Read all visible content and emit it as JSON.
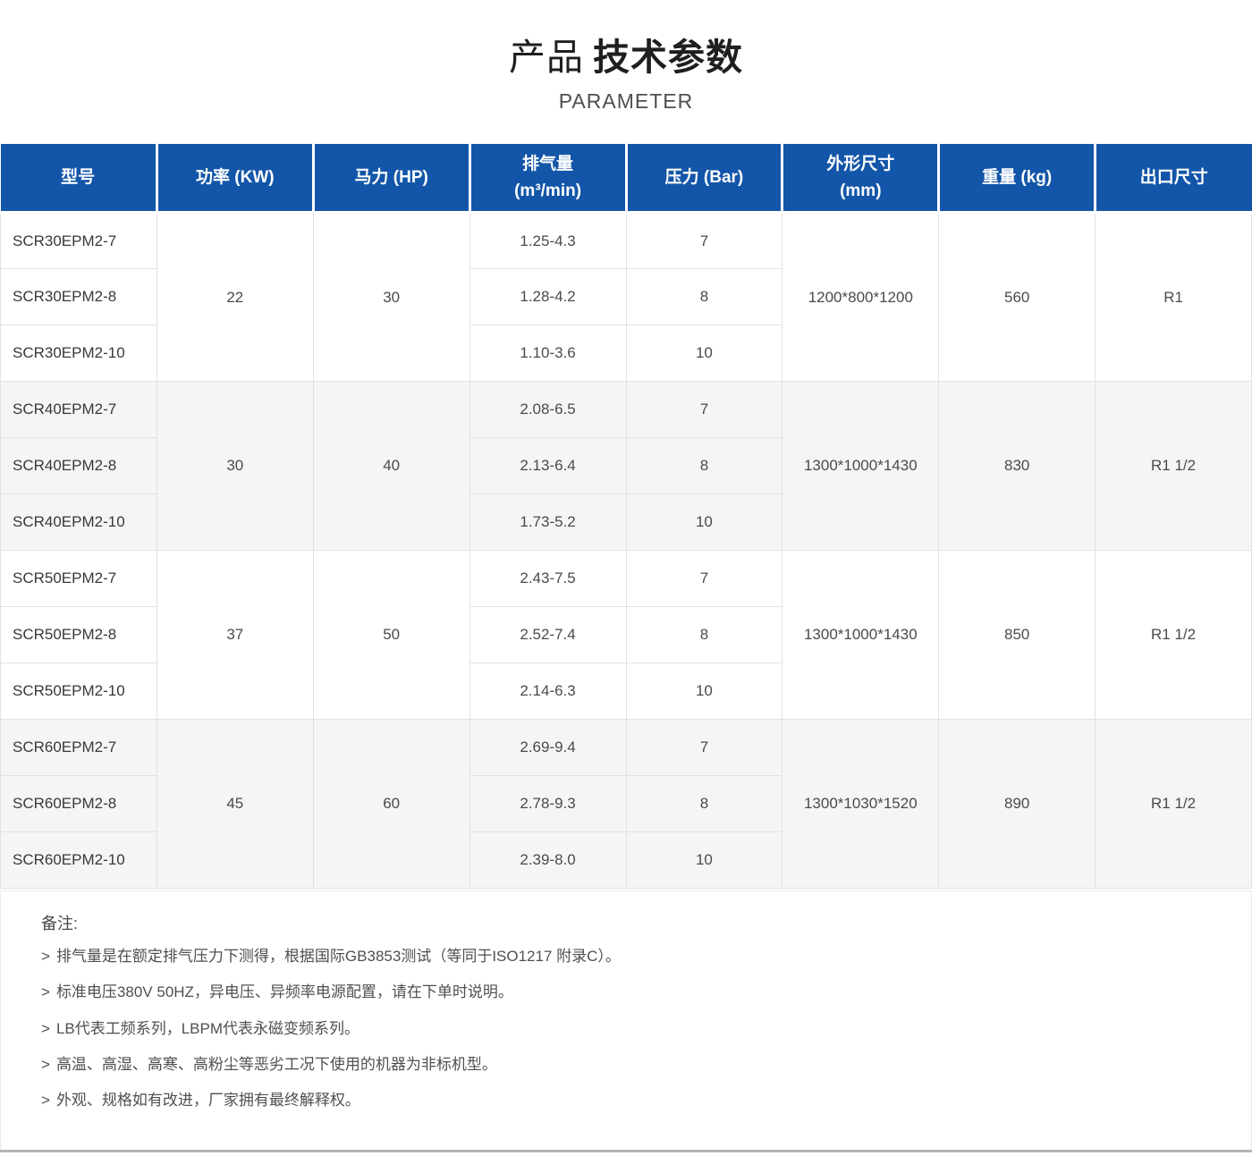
{
  "page": {
    "title_prefix": "产品",
    "title_main": "技术参数",
    "subtitle": "PARAMETER"
  },
  "table": {
    "columns": [
      {
        "label": "型号"
      },
      {
        "label": "功率 (KW)"
      },
      {
        "label": "马力 (HP)"
      },
      {
        "label": "排气量",
        "sub": "(m³/min)"
      },
      {
        "label": "压力 (Bar)"
      },
      {
        "label": "外形尺寸",
        "sub": "(mm)"
      },
      {
        "label": "重量 (kg)"
      },
      {
        "label": "出口尺寸"
      }
    ],
    "groups": [
      {
        "power": "22",
        "hp": "30",
        "dimensions": "1200*800*1200",
        "weight": "560",
        "outlet": "R1",
        "models": [
          {
            "model": "SCR30EPM2-7",
            "displacement": "1.25-4.3",
            "pressure": "7"
          },
          {
            "model": "SCR30EPM2-8",
            "displacement": "1.28-4.2",
            "pressure": "8"
          },
          {
            "model": "SCR30EPM2-10",
            "displacement": "1.10-3.6",
            "pressure": "10"
          }
        ]
      },
      {
        "power": "30",
        "hp": "40",
        "dimensions": "1300*1000*1430",
        "weight": "830",
        "outlet": "R1 1/2",
        "models": [
          {
            "model": "SCR40EPM2-7",
            "displacement": "2.08-6.5",
            "pressure": "7"
          },
          {
            "model": "SCR40EPM2-8",
            "displacement": "2.13-6.4",
            "pressure": "8"
          },
          {
            "model": "SCR40EPM2-10",
            "displacement": "1.73-5.2",
            "pressure": "10"
          }
        ]
      },
      {
        "power": "37",
        "hp": "50",
        "dimensions": "1300*1000*1430",
        "weight": "850",
        "outlet": "R1 1/2",
        "models": [
          {
            "model": "SCR50EPM2-7",
            "displacement": "2.43-7.5",
            "pressure": "7"
          },
          {
            "model": "SCR50EPM2-8",
            "displacement": "2.52-7.4",
            "pressure": "8"
          },
          {
            "model": "SCR50EPM2-10",
            "displacement": "2.14-6.3",
            "pressure": "10"
          }
        ]
      },
      {
        "power": "45",
        "hp": "60",
        "dimensions": "1300*1030*1520",
        "weight": "890",
        "outlet": "R1 1/2",
        "models": [
          {
            "model": "SCR60EPM2-7",
            "displacement": "2.69-9.4",
            "pressure": "7"
          },
          {
            "model": "SCR60EPM2-8",
            "displacement": "2.78-9.3",
            "pressure": "8"
          },
          {
            "model": "SCR60EPM2-10",
            "displacement": "2.39-8.0",
            "pressure": "10"
          }
        ]
      }
    ]
  },
  "notes": {
    "label": "备注:",
    "bullet": ">",
    "items": [
      "排气量是在额定排气压力下测得，根据国际GB3853测试（等同于ISO1217 附录C）。",
      "标准电压380V 50HZ，异电压、异频率电源配置，请在下单时说明。",
      "LB代表工频系列，LBPM代表永磁变频系列。",
      "高温、高湿、高寒、高粉尘等恶劣工况下使用的机器为非标机型。",
      "外观、规格如有改进，厂家拥有最终解释权。"
    ]
  },
  "colors": {
    "header_bg": "#1356a9",
    "header_text": "#ffffff",
    "row_alt_bg": "#f5f5f5",
    "border": "#e2e2e2",
    "text": "#4a4a4a",
    "divider": "#b5b5b5"
  }
}
